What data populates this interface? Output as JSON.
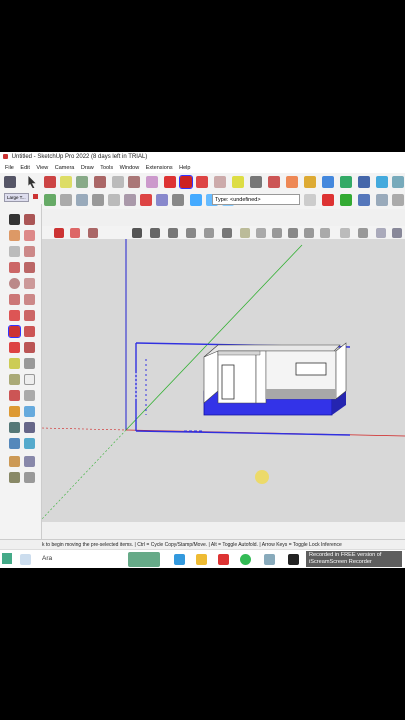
{
  "window": {
    "title": "Untitled - SketchUp Pro 2022 (8 days left in TRIAL)"
  },
  "menu": {
    "items": [
      "File",
      "Edit",
      "View",
      "Camera",
      "Draw",
      "Tools",
      "Window",
      "Extensions",
      "Help"
    ]
  },
  "tray": {
    "title": "Large T..."
  },
  "layer_select": {
    "value": "Type: <undefined>"
  },
  "status": {
    "text": "k to begin moving the pre-selected items. | Ctrl = Cycle Copy/Stamp/Move. | Alt = Toggle Autofold. | Arrow Keys = Toggle Lock Inference"
  },
  "taskbar": {
    "search_text": "Ara"
  },
  "watermark": {
    "line1": "Recorded in FREE version of",
    "line2": "iScreamScreen Recorder"
  },
  "colors": {
    "axis_red": "#d02020",
    "axis_green": "#33b033",
    "axis_blue": "#2020d0",
    "selection_blue": "#3030e0",
    "wall_white": "#ffffff",
    "floor_gray": "#8a8a8a"
  }
}
